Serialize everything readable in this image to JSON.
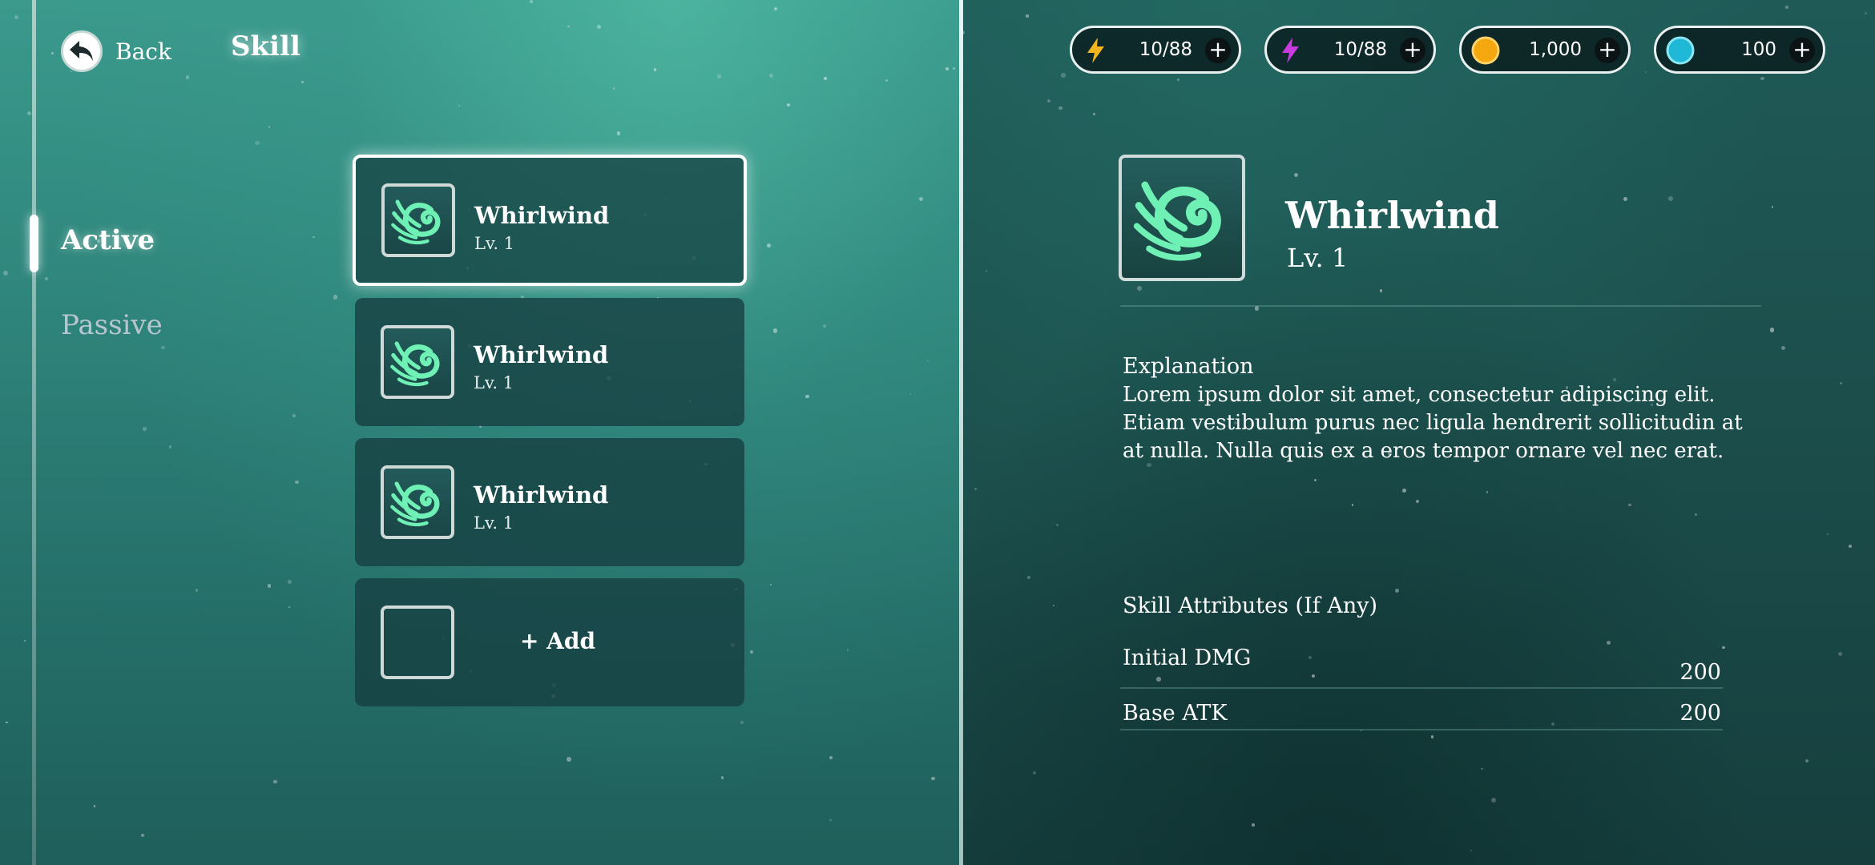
{
  "header": {
    "back_label": "Back",
    "title": "Skill"
  },
  "tabs": [
    {
      "label": "Active",
      "selected": true
    },
    {
      "label": "Passive",
      "selected": false
    }
  ],
  "skills": [
    {
      "name": "Whirlwind",
      "level": "Lv. 1",
      "icon": "whirlwind-icon",
      "selected": true
    },
    {
      "name": "Whirlwind",
      "level": "Lv. 1",
      "icon": "whirlwind-icon",
      "selected": false
    },
    {
      "name": "Whirlwind",
      "level": "Lv. 1",
      "icon": "whirlwind-icon",
      "selected": false
    }
  ],
  "add_slot": {
    "label": "+ Add"
  },
  "currencies": [
    {
      "icon": "lightning-yellow-icon",
      "color": "#f2b51e",
      "value": "10/88"
    },
    {
      "icon": "lightning-purple-icon",
      "color": "#c93be0",
      "value": "10/88"
    },
    {
      "icon": "coin-icon",
      "color": "#f5a70f",
      "value": "1,000"
    },
    {
      "icon": "gem-icon",
      "color": "#1fb8d6",
      "value": "100"
    }
  ],
  "detail": {
    "name": "Whirlwind",
    "level": "Lv. 1",
    "explanation_title": "Explanation",
    "explanation_text": "Lorem ipsum dolor sit amet, consectetur adipiscing elit. Etiam vestibulum purus nec ligula hendrerit sollicitudin at at nulla. Nulla quis ex a eros tempor ornare vel nec erat.",
    "attributes_title": "Skill Attributes (If Any)",
    "attributes": [
      {
        "label": "Initial DMG",
        "value": "200"
      },
      {
        "label": "Base ATK",
        "value": "200"
      }
    ]
  },
  "colors": {
    "accent_green": "#6ff0b4",
    "panel_dark": "#163e40"
  }
}
